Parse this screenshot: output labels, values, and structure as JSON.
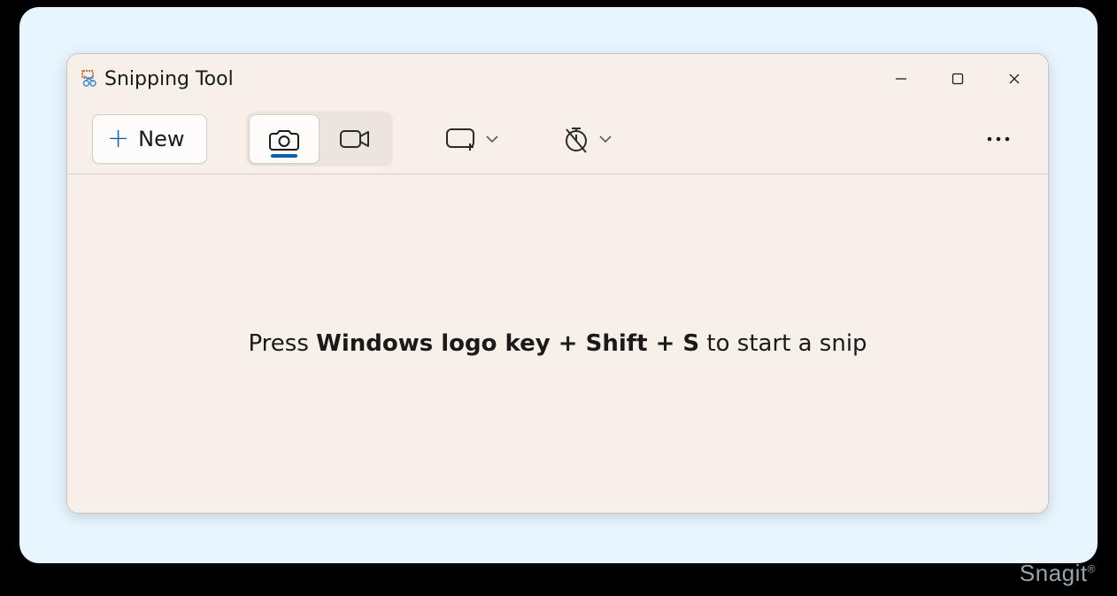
{
  "app": {
    "title": "Snipping Tool",
    "icon_name": "snipping-tool-icon"
  },
  "window_controls": {
    "minimize": "minimize",
    "maximize": "maximize",
    "close": "close"
  },
  "toolbar": {
    "new_label": "New",
    "modes": {
      "snip_name": "camera-icon",
      "record_name": "video-icon",
      "active": "snip"
    },
    "snip_shape_name": "rectangle-plus-icon",
    "delay_name": "no-delay-icon",
    "more_name": "more-icon"
  },
  "hint": {
    "prefix": "Press ",
    "shortcut": "Windows logo key + Shift + S",
    "suffix": " to start a snip"
  },
  "watermark": {
    "text": "Snagit",
    "reg": "®"
  }
}
